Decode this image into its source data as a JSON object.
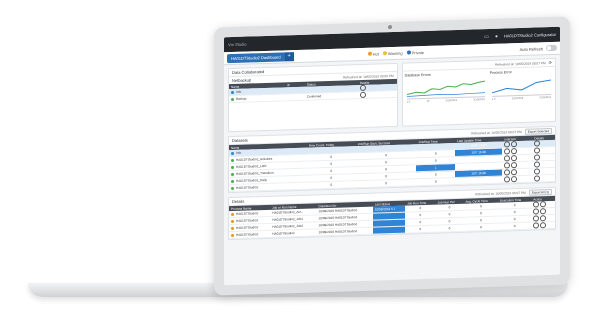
{
  "topbar": {
    "brand": "",
    "crumb": "Vm Studio",
    "user": "HA01DTStudio2  Configurator"
  },
  "tabbar": {
    "active_tab": "HA01DTStudio2 Dashboard",
    "add": "+",
    "legend": [
      {
        "label": "Hot",
        "color": "#f0a020"
      },
      {
        "label": "Warning",
        "color": "#e2c23a"
      },
      {
        "label": "Private",
        "color": "#2c6fb4"
      }
    ],
    "auto_refresh": "Auto Refresh"
  },
  "summary": {
    "meta": "Refreshed at: 10/05/2019 08:07 PM",
    "title": "Data Collaborated",
    "sub_title": "Refreshed at: 10/05/2019 03:00 PM",
    "section": "Netbackup",
    "columns": [
      "Name",
      "IP",
      "Status",
      "Details"
    ],
    "rows": [
      {
        "name": "Info",
        "ip": "",
        "status": "",
        "status_color": "#2f84d6",
        "selected": true
      },
      {
        "name": "Backup",
        "ip": "",
        "status": "Confirmed",
        "status_color": "#4caf50",
        "selected": false
      }
    ]
  },
  "stats": {
    "refreshed": "Refreshed at: 10/05/2019 08:07 PM",
    "left_title": "Database Errors",
    "right_title": "Process Error",
    "left_axis": [
      "1.0",
      "10",
      "2/10/2019",
      "3/10/2019"
    ],
    "right_axis": [
      "1.0",
      "2/10/2019",
      "3/10/2019"
    ]
  },
  "datasets": {
    "title": "Datasets",
    "refreshed": "Refreshed at: 10/05/2019 08:07 PM",
    "button": "Export Selected",
    "columns": [
      "Name",
      "Row Count, Today",
      "Job/Run Start, Success",
      "Job/Run Time",
      "Last Update Time",
      "Indicator",
      "Details"
    ],
    "rows": [
      {
        "name": "Info",
        "c1": "",
        "c2": "",
        "c3": "",
        "c4": "10/07 16:05",
        "blue_col": 4,
        "status_color": "#2f84d6",
        "selected": true
      },
      {
        "name": "HA01DTStudio2_Activities",
        "c1": "0",
        "c2": "0",
        "c3": "0",
        "c4": "10/7 16:06",
        "blue_col": 4,
        "status_color": "#4caf50",
        "selected": false
      },
      {
        "name": "HA01DTStudio2_LOR",
        "c1": "0",
        "c2": "0",
        "c3": "0",
        "c4": "",
        "blue_col": -1,
        "status_color": "#4caf50",
        "selected": false
      },
      {
        "name": "HA01DTStudio2_Transition",
        "c1": "0",
        "c2": "0",
        "c3": "1",
        "c4": "",
        "blue_col": 3,
        "status_color": "#4caf50",
        "selected": false
      },
      {
        "name": "HA01DTStudio2_Daily",
        "c1": "0",
        "c2": "0",
        "c3": "0",
        "c4": "10/7 16:06",
        "blue_col": 4,
        "status_color": "#4caf50",
        "selected": false
      },
      {
        "name": "HA01DTStudio2",
        "c1": "0",
        "c2": "0",
        "c3": "0",
        "c4": "",
        "blue_col": -1,
        "status_color": "#4caf50",
        "selected": false
      }
    ]
  },
  "details": {
    "title": "Details",
    "refreshed": "Refreshed at: 10/05/2019 08:07 PM",
    "button": "Export All (1)",
    "columns": [
      "Process Name",
      "Job or Run Name",
      "Date/Run Err",
      "Last Status",
      "Job Run Time",
      "Job Run Per",
      "Avg. Cycle Time",
      "Execution Time",
      "Action"
    ],
    "rows": [
      {
        "name": "HA01DTStudio2",
        "job": "HA01DTStudio2_Act...",
        "date": "10/09/2019 HA01DTStudio2",
        "status": "10/09/2019 5.7",
        "c5": "0",
        "c6": "0",
        "c7": "0",
        "c8": "0",
        "status_color": "#e39b1f"
      },
      {
        "name": "HA01DTStudio2",
        "job": "HA01DTStudio2_Job1",
        "date": "10/09/2019 HA01DTStudio2",
        "status": "",
        "c5": "0",
        "c6": "0",
        "c7": "0",
        "c8": "0",
        "status_color": "#e39b1f"
      },
      {
        "name": "HA01DTStudio2",
        "job": "HA01DTStudio2_Job2",
        "date": "10/09/2019 HA01DTStudio2",
        "status": "",
        "c5": "0",
        "c6": "0",
        "c7": "0",
        "c8": "0",
        "status_color": "#e39b1f"
      },
      {
        "name": "HA01DTStudio2",
        "job": "HA01DTStudio2",
        "date": "10/09/2019 HA01DTStudio2",
        "status": "",
        "c5": "0",
        "c6": "0",
        "c7": "0",
        "c8": "0",
        "status_color": "#e39b1f"
      }
    ]
  }
}
